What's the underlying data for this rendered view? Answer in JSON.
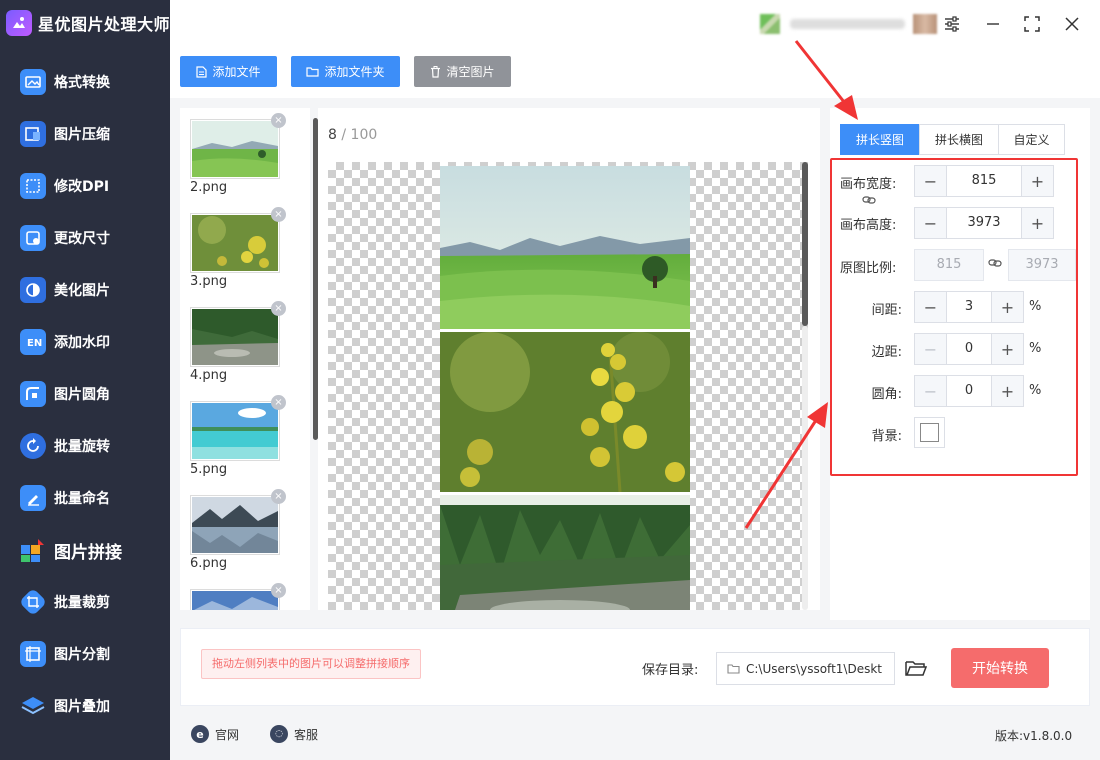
{
  "app": {
    "title": "星优图片处理大师"
  },
  "sidebar": {
    "items": [
      {
        "label": "格式转换",
        "icon": "format-convert-icon",
        "color": "#3d8ef8"
      },
      {
        "label": "图片压缩",
        "icon": "image-compress-icon",
        "color": "#3d8ef8"
      },
      {
        "label": "修改DPI",
        "icon": "dpi-icon",
        "color": "#3d8ef8"
      },
      {
        "label": "更改尺寸",
        "icon": "resize-icon",
        "color": "#3d8ef8"
      },
      {
        "label": "美化图片",
        "icon": "beautify-icon",
        "color": "#3d8ef8"
      },
      {
        "label": "添加水印",
        "icon": "watermark-icon",
        "color": "#3d8ef8"
      },
      {
        "label": "图片圆角",
        "icon": "round-corner-icon",
        "color": "#3d8ef8"
      },
      {
        "label": "批量旋转",
        "icon": "rotate-icon",
        "color": "#3d8ef8"
      },
      {
        "label": "批量命名",
        "icon": "rename-icon",
        "color": "#3d8ef8"
      },
      {
        "label": "图片拼接",
        "icon": "stitch-icon",
        "color": "#3d8ef8",
        "active": true
      },
      {
        "label": "批量裁剪",
        "icon": "crop-icon",
        "color": "#3d8ef8"
      },
      {
        "label": "图片分割",
        "icon": "split-icon",
        "color": "#3d8ef8"
      },
      {
        "label": "图片叠加",
        "icon": "overlay-icon",
        "color": "#3d8ef8"
      }
    ]
  },
  "toolbar": {
    "add_file": "添加文件",
    "add_folder": "添加文件夹",
    "clear_images": "清空图片"
  },
  "thumbnails": [
    {
      "name": "2.png"
    },
    {
      "name": "3.png"
    },
    {
      "name": "4.png"
    },
    {
      "name": "5.png"
    },
    {
      "name": "6.png"
    }
  ],
  "preview": {
    "count": "8",
    "separator": " / ",
    "max": "100"
  },
  "settings": {
    "tabs": [
      "拼长竖图",
      "拼长横图",
      "自定义"
    ],
    "active_tab": 0,
    "canvas_width_label": "画布宽度:",
    "canvas_width": "815",
    "canvas_height_label": "画布高度:",
    "canvas_height": "3973",
    "ratio_label": "原图比例:",
    "ratio_width": "815",
    "ratio_height": "3973",
    "spacing_label": "间距:",
    "spacing": "3",
    "margin_label": "边距:",
    "margin": "0",
    "radius_label": "圆角:",
    "radius": "0",
    "percent": "%",
    "background_label": "背景:",
    "background_color": "#ffffff"
  },
  "bottom": {
    "hint": "拖动左侧列表中的图片可以调整拼接顺序",
    "save_label": "保存目录:",
    "save_path": "C:\\Users\\yssoft1\\Deskt",
    "start_button": "开始转换"
  },
  "footer": {
    "website": "官网",
    "service": "客服",
    "version": "版本:v1.8.0.0"
  },
  "colors": {
    "sidebar_bg": "#2a2f3f",
    "accent": "#3d8ef8",
    "danger": "#f56c6c",
    "highlight_red": "#f03535"
  }
}
